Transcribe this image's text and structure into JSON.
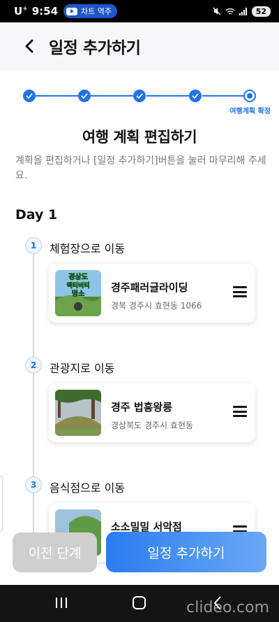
{
  "status_bar": {
    "carrier": "U",
    "carrier_sup": "+",
    "time": "9:54",
    "notification_pill": "차트 역주",
    "battery": "52",
    "icons": [
      "mute-icon",
      "wifi-icon",
      "signal-icon",
      "battery-icon"
    ]
  },
  "header": {
    "back_icon": "chevron-left-icon",
    "title": "일정 추가하기"
  },
  "stepper": {
    "steps_completed": 4,
    "total_steps": 5,
    "current_step_label": "여행계획 확정",
    "accent_color": "#2273e8"
  },
  "section": {
    "title": "여행 계획 편집하기",
    "description": "계획을 편집하거나 [일정 추가하기]버튼을 눌러 마무리해 주세요."
  },
  "day": {
    "label": "Day 1",
    "stops": [
      {
        "number": "1",
        "title": "체험장으로 이동",
        "place_name": "경주패러글라이딩",
        "address": "경북 경주시 효현동 1066",
        "thumb_text": [
          "경상도",
          "액티비티",
          "명소"
        ]
      },
      {
        "number": "2",
        "title": "관광지로 이동",
        "place_name": "경주 법흥왕릉",
        "address": "경상북도 경주시 효현동"
      },
      {
        "number": "3",
        "title": "음식점으로 이동",
        "place_name": "소소밀밀 서악점",
        "address": ""
      }
    ]
  },
  "buttons": {
    "prev": "이전 단계",
    "add": "일정 추가하기"
  },
  "nav_bar": {
    "icons": [
      "recent-apps-icon",
      "home-icon",
      "back-icon"
    ],
    "watermark": "clideo.com"
  }
}
